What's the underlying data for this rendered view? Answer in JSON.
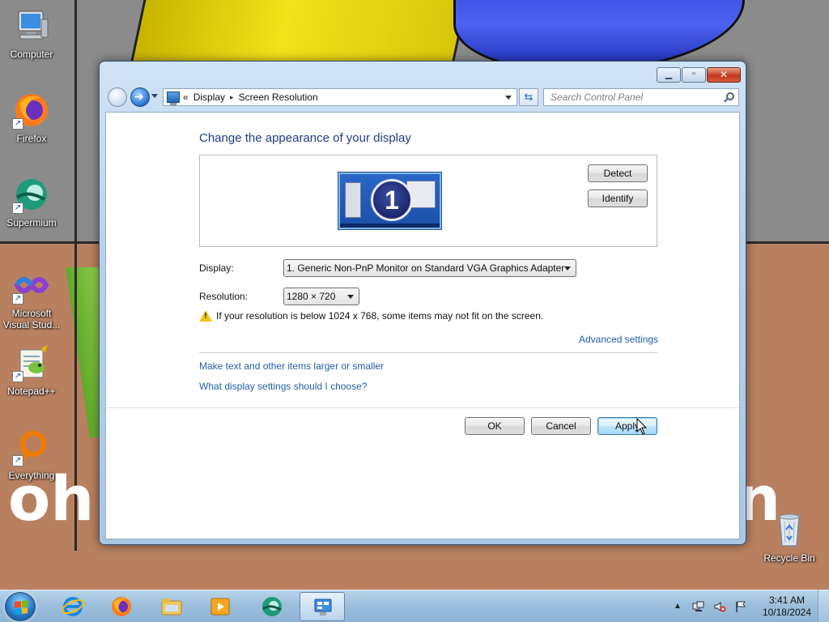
{
  "desktop": {
    "icons": [
      {
        "label": "Computer",
        "icon": "computer-icon"
      },
      {
        "label": "Firefox",
        "icon": "firefox-icon"
      },
      {
        "label": "Supermium",
        "icon": "supermium-icon"
      },
      {
        "label": "Microsoft Visual Stud...",
        "icon": "visual-studio-icon"
      },
      {
        "label": "Notepad++",
        "icon": "notepadpp-icon"
      },
      {
        "label": "Everything",
        "icon": "everything-icon"
      },
      {
        "label": "Recycle Bin",
        "icon": "recycle-bin-icon"
      }
    ],
    "wallpaper_text_left": "oh",
    "wallpaper_text_right": "n"
  },
  "window": {
    "address": {
      "chevron": "«",
      "crumbs": [
        "Display",
        "Screen Resolution"
      ],
      "separator": "▸"
    },
    "search": {
      "placeholder": "Search Control Panel"
    },
    "heading": "Change the appearance of your display",
    "monitor_number": "1",
    "detect_label": "Detect",
    "identify_label": "Identify",
    "display": {
      "label": "Display:",
      "value": "1. Generic Non-PnP Monitor on Standard VGA Graphics Adapter"
    },
    "resolution": {
      "label": "Resolution:",
      "value": "1280 × 720"
    },
    "warning_text": "If your resolution is below 1024 x 768, some items may not fit on the screen.",
    "advanced_link": "Advanced settings",
    "links": [
      "Make text and other items larger or smaller",
      "What display settings should I choose?"
    ],
    "buttons": {
      "ok": "OK",
      "cancel": "Cancel",
      "apply": "Apply"
    }
  },
  "taskbar": {
    "clock_time": "3:41 AM",
    "clock_date": "10/18/2024",
    "pinned": [
      "internet-explorer-icon",
      "firefox-icon",
      "file-explorer-icon",
      "media-player-icon",
      "supermium-icon",
      "control-panel-icon"
    ]
  },
  "colors": {
    "link": "#1f5fa8",
    "heading": "#1e3b8a",
    "taskbar": "#9cbfdc"
  }
}
